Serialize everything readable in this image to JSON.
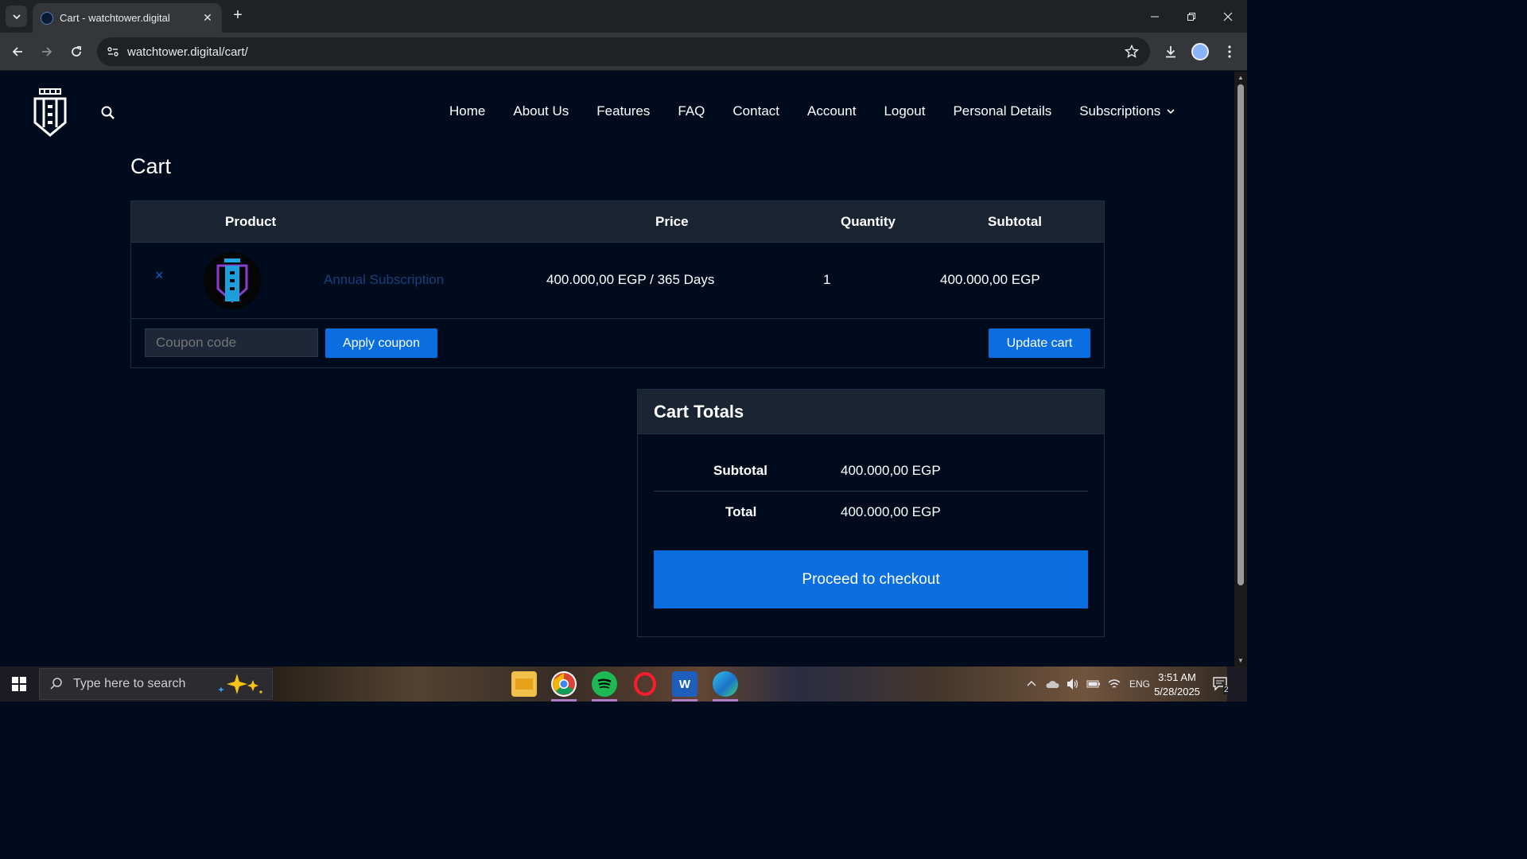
{
  "browser": {
    "tab_title": "Cart - watchtower.digital",
    "url": "watchtower.digital/cart/"
  },
  "site": {
    "nav": [
      {
        "label": "Home"
      },
      {
        "label": "About Us"
      },
      {
        "label": "Features"
      },
      {
        "label": "FAQ"
      },
      {
        "label": "Contact"
      },
      {
        "label": "Account"
      },
      {
        "label": "Logout"
      },
      {
        "label": "Personal Details"
      },
      {
        "label": "Subscriptions"
      }
    ]
  },
  "cart": {
    "title": "Cart",
    "headers": {
      "product": "Product",
      "price": "Price",
      "quantity": "Quantity",
      "subtotal": "Subtotal"
    },
    "items": [
      {
        "name": "Annual Subscription",
        "price": "400.000,00 EGP / 365 Days",
        "quantity": "1",
        "subtotal": "400.000,00 EGP"
      }
    ],
    "coupon_placeholder": "Coupon code",
    "apply_coupon_label": "Apply coupon",
    "update_cart_label": "Update cart"
  },
  "totals": {
    "title": "Cart Totals",
    "subtotal_label": "Subtotal",
    "subtotal_value": "400.000,00 EGP",
    "total_label": "Total",
    "total_value": "400.000,00 EGP",
    "checkout_label": "Proceed to checkout"
  },
  "taskbar": {
    "search_placeholder": "Type here to search",
    "language": "ENG",
    "time": "3:51 AM",
    "date": "5/28/2025",
    "notification_count": "2"
  },
  "colors": {
    "page_bg": "#000c1e",
    "accent": "#0a6ee0",
    "header_bg": "#1b2433",
    "product_link": "#1b3e78"
  }
}
